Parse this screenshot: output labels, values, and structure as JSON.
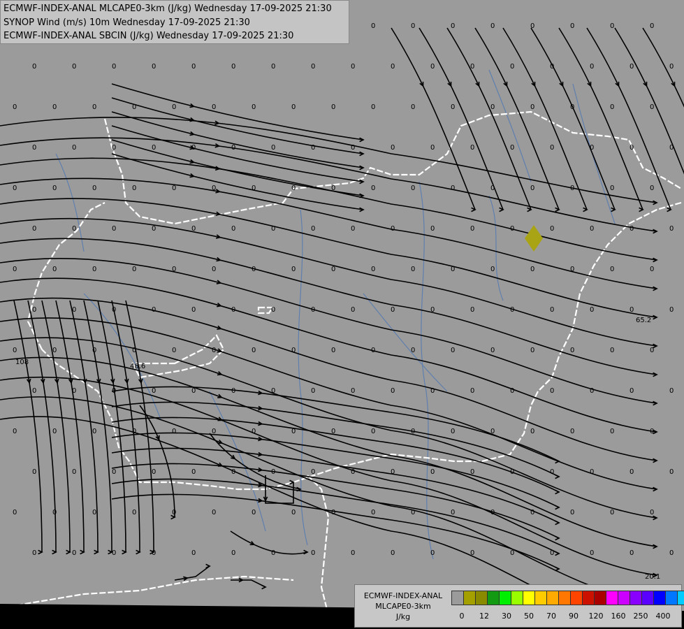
{
  "header": {
    "lines": [
      "ECMWF-INDEX-ANAL MLCAPE0-3km (J/kg) Wednesday 17-09-2025 21:30",
      "SYNOP Wind (m/s) 10m Wednesday 17-09-2025 21:30",
      "ECMWF-INDEX-ANAL SBCIN (J/kg) Wednesday 17-09-2025 21:30"
    ]
  },
  "map": {
    "background_color": "#9b9b9b",
    "streamline_color": "#000000",
    "border_color": "#ffffff",
    "river_color": "#5f7fae",
    "cape_value_labels": [
      "65.2",
      "48.6",
      "108",
      "20.1"
    ],
    "zero_label": "0",
    "highlight_color": "#a9a416"
  },
  "legend": {
    "title_lines": [
      "ECMWF-INDEX-ANAL",
      "MLCAPE0-3km",
      "J/kg"
    ],
    "colors": [
      "#9b9b9b",
      "#a3a000",
      "#8a8a00",
      "#129a12",
      "#00ee00",
      "#99ff00",
      "#ffff00",
      "#ffcc00",
      "#ffaa00",
      "#ff7700",
      "#ff4400",
      "#cc1100",
      "#aa0000",
      "#ff00ff",
      "#cc00ff",
      "#8a00ff",
      "#5a00ff",
      "#0000ff",
      "#0077ff",
      "#00ccff",
      "#66ffff",
      "#ffffff"
    ],
    "ticks": [
      "0",
      "12",
      "30",
      "50",
      "70",
      "90",
      "120",
      "160",
      "250",
      "400"
    ]
  }
}
